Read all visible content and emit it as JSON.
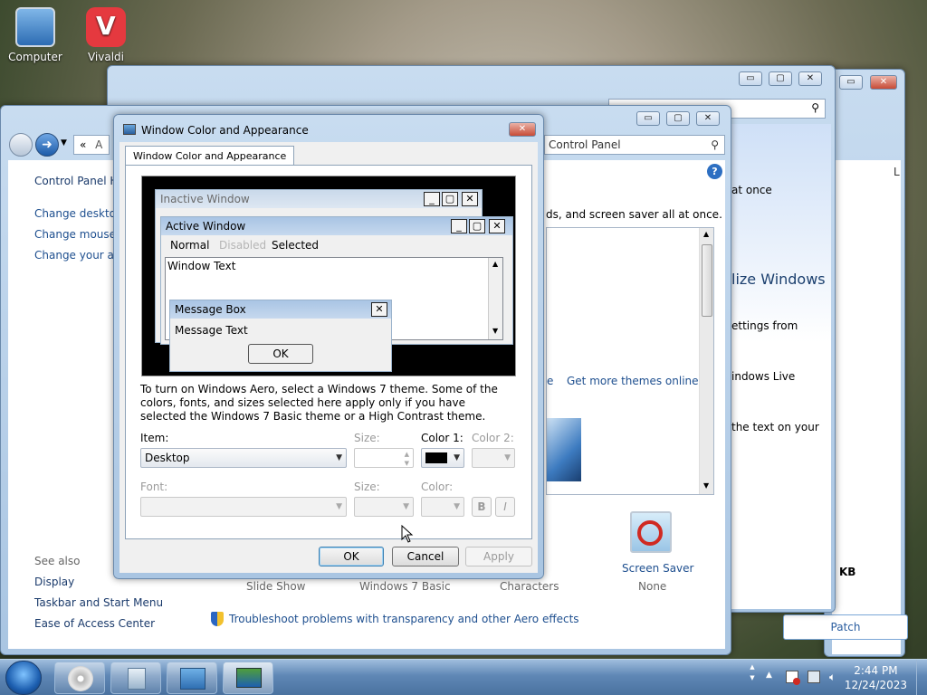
{
  "desktop": {
    "icons": [
      {
        "label": "Computer"
      },
      {
        "label": "Vivaldi"
      }
    ]
  },
  "back_window": {
    "left_text": "at once",
    "heading": "lize Windows",
    "lines": [
      "ettings from",
      "indows Live",
      "the text on your"
    ],
    "size_col": "KB",
    "column_l": "L",
    "patch_button": "Patch"
  },
  "cp_window": {
    "address_tail": "Control Panel",
    "address_chevron": "«",
    "address_first": "A",
    "help_glyph": "?",
    "sidebar": {
      "home": "Control Panel Ho",
      "links": [
        "Change desktop",
        "Change mouse p",
        "Change your acc"
      ],
      "see_also_title": "See also",
      "see_also": [
        "Display",
        "Taskbar and Start Menu",
        "Ease of Access Center"
      ]
    },
    "description": "ds, and screen saver all at once.",
    "themes_link_partial": "e",
    "get_more_themes": "Get more themes online",
    "bottom_items": [
      {
        "label": "Slide Show"
      },
      {
        "label": "Windows 7 Basic"
      },
      {
        "label": "Characters"
      }
    ],
    "screen_saver": {
      "label": "Screen Saver",
      "value": "None"
    },
    "troubleshoot": "Troubleshoot problems with transparency and other Aero effects"
  },
  "dialog": {
    "title": "Window Color and Appearance",
    "tab": "Window Color and Appearance",
    "preview": {
      "inactive_title": "Inactive Window",
      "active_title": "Active Window",
      "menu": [
        "Normal",
        "Disabled",
        "Selected"
      ],
      "window_text": "Window Text",
      "msgbox_title": "Message Box",
      "msgbox_text": "Message Text",
      "msgbox_ok": "OK"
    },
    "info": "To turn on Windows Aero, select a Windows 7 theme.  Some of the colors, fonts, and sizes selected here apply only if you have selected the Windows 7 Basic theme or a High Contrast theme.",
    "item_label": "Item:",
    "item_value": "Desktop",
    "size_label": "Size:",
    "color1_label": "Color 1:",
    "color1_value": "#000000",
    "color2_label": "Color 2:",
    "font_label": "Font:",
    "font_size_label": "Size:",
    "font_color_label": "Color:",
    "bold": "B",
    "italic": "I",
    "ok": "OK",
    "cancel": "Cancel",
    "apply": "Apply"
  },
  "taskbar": {
    "time": "2:44 PM",
    "date": "12/24/2023"
  },
  "colors": {
    "link": "#1e4f8f",
    "taskbar": "#5f87b5"
  }
}
